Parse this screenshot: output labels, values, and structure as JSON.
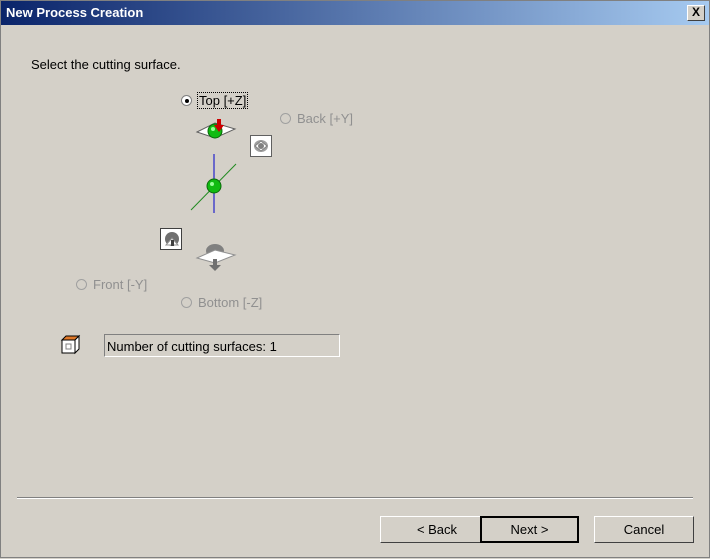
{
  "window": {
    "title": "New Process Creation",
    "close_label": "X"
  },
  "prompt": "Select the cutting surface.",
  "surfaces": {
    "top": {
      "label": "Top [+Z]",
      "checked": true,
      "enabled": true
    },
    "back": {
      "label": "Back [+Y]",
      "checked": false,
      "enabled": false
    },
    "front": {
      "label": "Front [-Y]",
      "checked": false,
      "enabled": false
    },
    "bottom": {
      "label": "Bottom [-Z]",
      "checked": false,
      "enabled": false
    }
  },
  "count_text": "Number of cutting surfaces: 1",
  "buttons": {
    "back": "< Back",
    "next": "Next >",
    "cancel": "Cancel"
  },
  "colors": {
    "sphere": "#11bb11",
    "arrow": "#cc0000",
    "z_axis": "#0000cc",
    "y_axis": "#228b22"
  }
}
